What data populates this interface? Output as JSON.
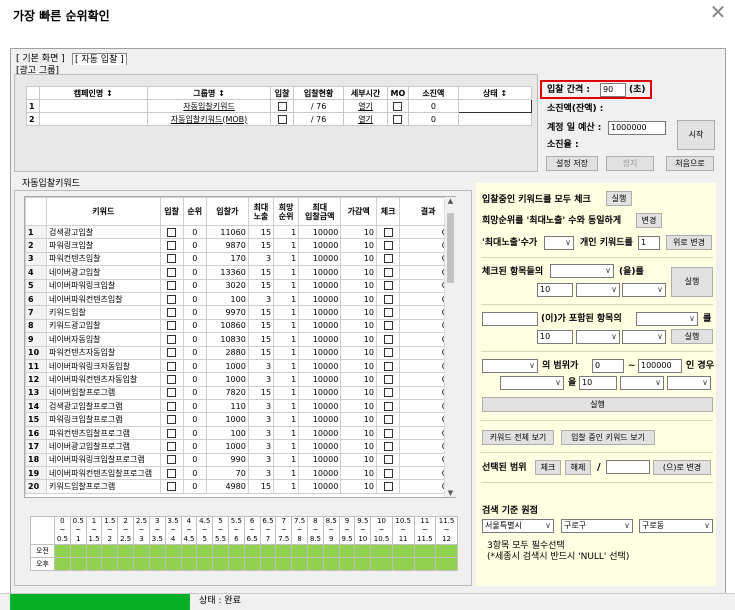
{
  "window": {
    "title": "가장 빠른 순위확인"
  },
  "tabs": [
    "[ 기본 화면 ]",
    "[ 자동 입찰 ]"
  ],
  "ad_group": {
    "label": "[광고 그룹]",
    "headers": [
      "캠페인명 ↕",
      "그룹명 ↕",
      "입찰",
      "입찰현황",
      "세부시간",
      "MO",
      "소진액",
      "상태 ↕"
    ],
    "rows": [
      {
        "num": "1",
        "campaign": "",
        "group": "자동입찰키워드",
        "bid_status": "/ 76",
        "detail": "열기",
        "spent": "0",
        "state": ""
      },
      {
        "num": "2",
        "campaign": "",
        "group": "자동입찰키워드(MOB)",
        "bid_status": "/ 76",
        "detail": "열기",
        "spent": "0",
        "state": ""
      }
    ]
  },
  "bid_panel": {
    "interval_label": "입찰 간격 :",
    "interval_value": "90",
    "interval_unit": "(초)",
    "spent_label": "소진액(잔액) :",
    "budget_label": "계정 일 예산 :",
    "budget_value": "1000000",
    "rate_label": "소진율 :",
    "start_button": "시작",
    "save_button": "설정 저장",
    "stop_button": "정지",
    "first_button": "처음으로",
    "highlight_color": "#e00000"
  },
  "keywords": {
    "label": "자동입찰키워드",
    "headers": [
      "",
      "키워드",
      "입찰",
      "순위",
      "입찰가",
      "최대\n노출",
      "희망\n순위",
      "최대\n입찰금액",
      "가감액",
      "체크",
      "결과"
    ],
    "rows": [
      {
        "n": "1",
        "kw": "검색광고입찰",
        "rank": "0",
        "price": "11060",
        "maxexp": "15",
        "hope": "1",
        "maxbid": "10000",
        "adj": "10",
        "result": "ON"
      },
      {
        "n": "2",
        "kw": "파워링크입찰",
        "rank": "0",
        "price": "9870",
        "maxexp": "15",
        "hope": "1",
        "maxbid": "10000",
        "adj": "10",
        "result": "ON"
      },
      {
        "n": "3",
        "kw": "파워컨텐츠입찰",
        "rank": "0",
        "price": "170",
        "maxexp": "3",
        "hope": "1",
        "maxbid": "10000",
        "adj": "10",
        "result": "ON"
      },
      {
        "n": "4",
        "kw": "네이버광고입찰",
        "rank": "0",
        "price": "13360",
        "maxexp": "15",
        "hope": "1",
        "maxbid": "10000",
        "adj": "10",
        "result": "ON"
      },
      {
        "n": "5",
        "kw": "네이버파워링크입찰",
        "rank": "0",
        "price": "3020",
        "maxexp": "15",
        "hope": "1",
        "maxbid": "10000",
        "adj": "10",
        "result": "ON"
      },
      {
        "n": "6",
        "kw": "네이버파워컨텐츠입찰",
        "rank": "0",
        "price": "100",
        "maxexp": "3",
        "hope": "1",
        "maxbid": "10000",
        "adj": "10",
        "result": "ON"
      },
      {
        "n": "7",
        "kw": "키워드입찰",
        "rank": "0",
        "price": "9970",
        "maxexp": "15",
        "hope": "1",
        "maxbid": "10000",
        "adj": "10",
        "result": "ON"
      },
      {
        "n": "8",
        "kw": "키워드광고입찰",
        "rank": "0",
        "price": "10860",
        "maxexp": "15",
        "hope": "1",
        "maxbid": "10000",
        "adj": "10",
        "result": "ON"
      },
      {
        "n": "9",
        "kw": "네이버자동입찰",
        "rank": "0",
        "price": "10830",
        "maxexp": "15",
        "hope": "1",
        "maxbid": "10000",
        "adj": "10",
        "result": "ON"
      },
      {
        "n": "10",
        "kw": "파워컨텐츠자동입찰",
        "rank": "0",
        "price": "2880",
        "maxexp": "15",
        "hope": "1",
        "maxbid": "10000",
        "adj": "10",
        "result": "ON"
      },
      {
        "n": "11",
        "kw": "네이버파워링크자동입찰",
        "rank": "0",
        "price": "1000",
        "maxexp": "3",
        "hope": "1",
        "maxbid": "10000",
        "adj": "10",
        "result": "ON"
      },
      {
        "n": "12",
        "kw": "네이버파워컨텐츠자동입찰",
        "rank": "0",
        "price": "1000",
        "maxexp": "3",
        "hope": "1",
        "maxbid": "10000",
        "adj": "10",
        "result": "ON"
      },
      {
        "n": "13",
        "kw": "네이버입찰프로그램",
        "rank": "0",
        "price": "7820",
        "maxexp": "15",
        "hope": "1",
        "maxbid": "10000",
        "adj": "10",
        "result": "ON"
      },
      {
        "n": "14",
        "kw": "검색광고입찰프로그램",
        "rank": "0",
        "price": "110",
        "maxexp": "3",
        "hope": "1",
        "maxbid": "10000",
        "adj": "10",
        "result": "ON"
      },
      {
        "n": "15",
        "kw": "파워링크입찰프로그램",
        "rank": "0",
        "price": "1000",
        "maxexp": "3",
        "hope": "1",
        "maxbid": "10000",
        "adj": "10",
        "result": "ON"
      },
      {
        "n": "16",
        "kw": "파워컨텐츠입찰프로그램",
        "rank": "0",
        "price": "100",
        "maxexp": "3",
        "hope": "1",
        "maxbid": "10000",
        "adj": "10",
        "result": "ON"
      },
      {
        "n": "17",
        "kw": "네이버광고입찰프로그램",
        "rank": "0",
        "price": "1000",
        "maxexp": "3",
        "hope": "1",
        "maxbid": "10000",
        "adj": "10",
        "result": "ON"
      },
      {
        "n": "18",
        "kw": "네이버파워링크입찰프로그램",
        "rank": "0",
        "price": "990",
        "maxexp": "3",
        "hope": "1",
        "maxbid": "10000",
        "adj": "10",
        "result": "ON"
      },
      {
        "n": "19",
        "kw": "네이버파워컨텐츠입찰프로그램",
        "rank": "0",
        "price": "70",
        "maxexp": "3",
        "hope": "1",
        "maxbid": "10000",
        "adj": "10",
        "result": "ON"
      },
      {
        "n": "20",
        "kw": "키워드입찰프로그램",
        "rank": "0",
        "price": "4980",
        "maxexp": "15",
        "hope": "1",
        "maxbid": "10000",
        "adj": "10",
        "result": "ON"
      }
    ]
  },
  "timetable": {
    "top": [
      "0",
      "0.5",
      "1",
      "1.5",
      "2",
      "2.5",
      "3",
      "3.5",
      "4",
      "4.5",
      "5",
      "5.5",
      "6",
      "6.5",
      "7",
      "7.5",
      "8",
      "8.5",
      "9",
      "9.5",
      "10",
      "10.5",
      "11",
      "11.5"
    ],
    "tilde": "~",
    "bottom": [
      "0.5",
      "1",
      "1.5",
      "2",
      "2.5",
      "3",
      "3.5",
      "4",
      "4.5",
      "5",
      "5.5",
      "6",
      "6.5",
      "7",
      "7.5",
      "8",
      "8.5",
      "9",
      "9.5",
      "10",
      "10.5",
      "11",
      "11.5",
      "12"
    ],
    "am": "오전",
    "pm": "오후",
    "fill_color": "#92d050"
  },
  "side": {
    "check_all_label": "입찰중인 키워드를 모두 체크",
    "run": "실행",
    "hope_label": "희망순위를 '최대노출' 수와 동일하게",
    "change": "변경",
    "maxexp_label": "'최대노출'수가",
    "personal_kw_label": "개인 키워드를",
    "personal_kw_value": "1",
    "up_change": "위로 변경",
    "checked_items_label": "체크된 항목들의",
    "eul_label": "(을)를",
    "val10": "10",
    "contains_label": "(이)가 포함된 항목의",
    "reul": "를",
    "range_label": "의 범위가",
    "range_from": "0",
    "range_to": "100000",
    "in_case": "인 경우",
    "eul2": "을",
    "view_all_kw": "키워드 전체 보기",
    "view_bidding_kw": "입찰 중인 키워드 보기",
    "selected_range_label": "선택된 범위",
    "check": "체크",
    "uncheck": "해제",
    "slash": "/",
    "to_change": "(으)로 변경",
    "search_base_label": "검색 기준 원점",
    "region1": "서울특별시",
    "region2": "구로구",
    "region3": "구로동",
    "note1": "3항목 모두 필수선택",
    "note2": "(*세종시 검색시 반드시 'NULL' 선택)"
  },
  "status": {
    "text": "상태 : 완료",
    "progress": 1.0,
    "progress_color": "#06b025"
  }
}
